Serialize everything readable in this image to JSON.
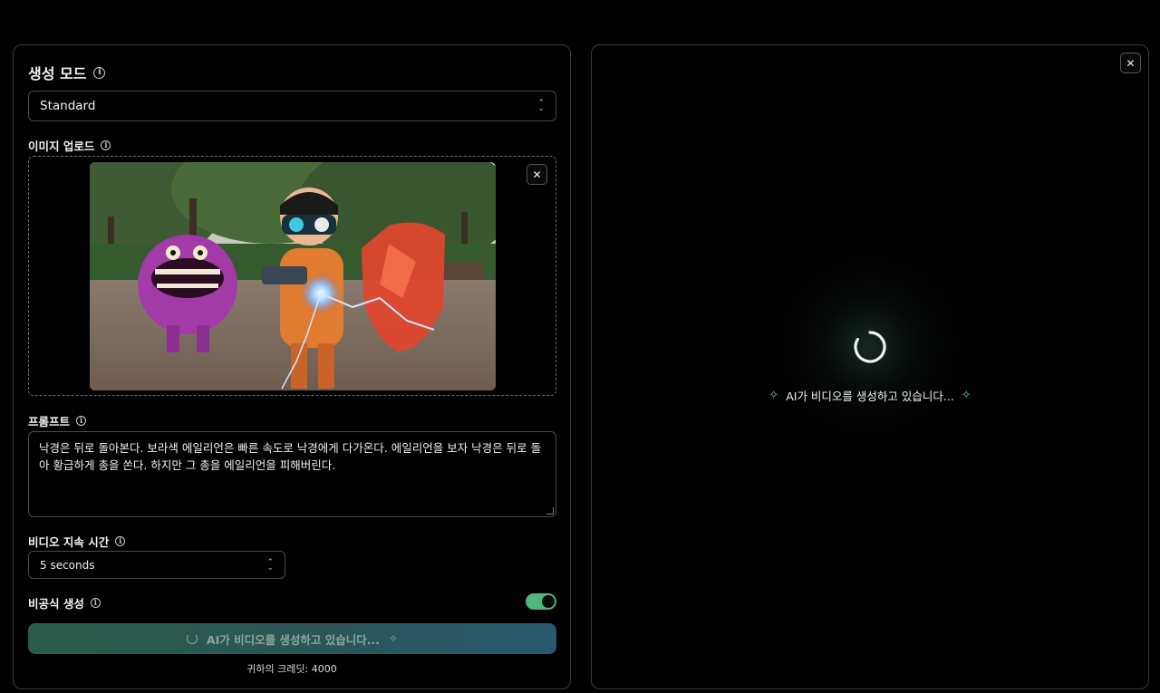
{
  "left_panel": {
    "mode_title": "생성 모드",
    "mode_value": "Standard",
    "upload_label": "이미지 업로드",
    "prompt_label": "프롬프트",
    "prompt_text": "낙경은 뒤로 돌아본다. 보라색 에일리언은 빠른 속도로 낙경에게 다가온다. 에일리언을 보자 낙경은 뒤로 돌아 황급하게 총을 쏜다. 하지만 그 총을 에일리언을 피해버린다.",
    "duration_label": "비디오 지속 시간",
    "duration_value": "5 seconds",
    "private_label": "비공식 생성",
    "private_enabled": true,
    "generate_button_label": "AI가 비디오를 생성하고 있습니다...",
    "credits_text": "귀하의 크레딧: 4000"
  },
  "right_panel": {
    "status_text": "AI가 비디오를 생성하고 있습니다..."
  },
  "icons": {
    "info": "info-icon",
    "close": "close-icon",
    "chevron": "chevron-updown-icon",
    "spinner": "loading-spinner-icon",
    "sparkle": "sparkle-icon"
  },
  "colors": {
    "accent_green": "#4fb57e",
    "button_gradient_start": "#2a5c49",
    "button_gradient_end": "#285a6e",
    "border": "#3a3a3a"
  }
}
